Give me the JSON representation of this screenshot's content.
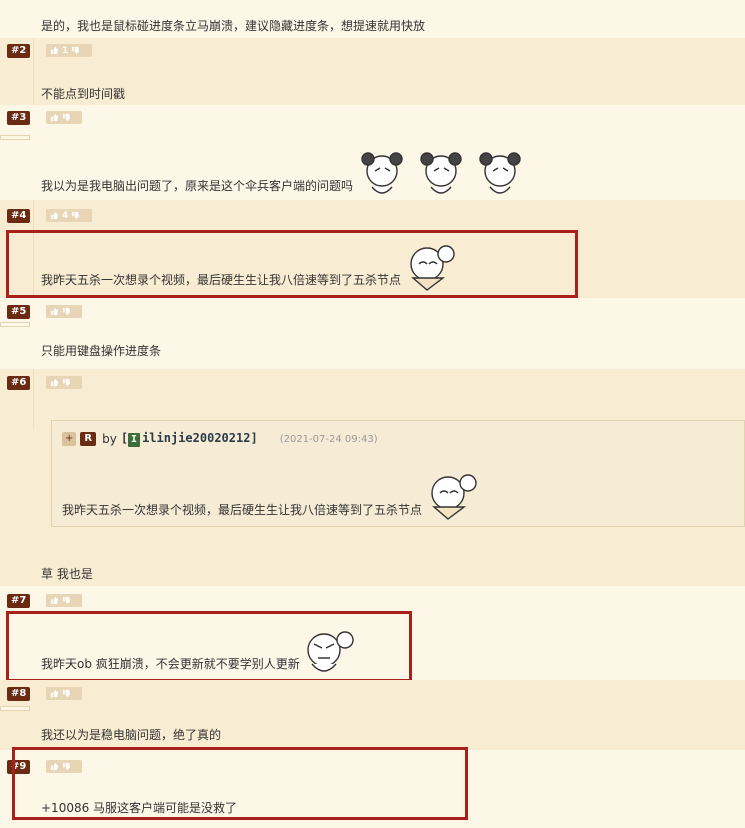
{
  "posts": [
    {
      "floor": "",
      "text": "是的，我也是鼠标碰进度条立马崩溃，建议隐藏进度条，想提速就用快放"
    },
    {
      "floor": "#2",
      "likes": "1",
      "text": "不能点到时间戳"
    },
    {
      "floor": "#3",
      "likes": "",
      "text": "我以为是我电脑出问题了，原来是这个伞兵客户端的问题吗"
    },
    {
      "floor": "#4",
      "likes": "4",
      "text": "我昨天五杀一次想录个视频，最后硬生生让我八倍速等到了五杀节点"
    },
    {
      "floor": "#5",
      "likes": "",
      "text": "只能用键盘操作进度条"
    },
    {
      "floor": "#6",
      "likes": "",
      "text": "草 我也是",
      "quote": {
        "plus": "+",
        "r": "R",
        "by": "by",
        "user_badge": "I",
        "user": "ilinjie20020212",
        "time": "(2021-07-24 09:43)",
        "text": "我昨天五杀一次想录个视频，最后硬生生让我八倍速等到了五杀节点"
      }
    },
    {
      "floor": "#7",
      "likes": "",
      "text": "我昨天ob 疯狂崩溃，不会更新就不要学别人更新"
    },
    {
      "floor": "#8",
      "likes": "",
      "text": "我还以为是稳电脑问题，绝了真的"
    },
    {
      "floor": "#9",
      "likes": "",
      "text": "+10086 马服这客户端可能是没救了"
    }
  ],
  "colors": {
    "floor_badge": "#6b2a12",
    "highlight_box": "#a8221b",
    "row_light": "#fdf7e8",
    "row_dark": "#f8ecd2"
  }
}
